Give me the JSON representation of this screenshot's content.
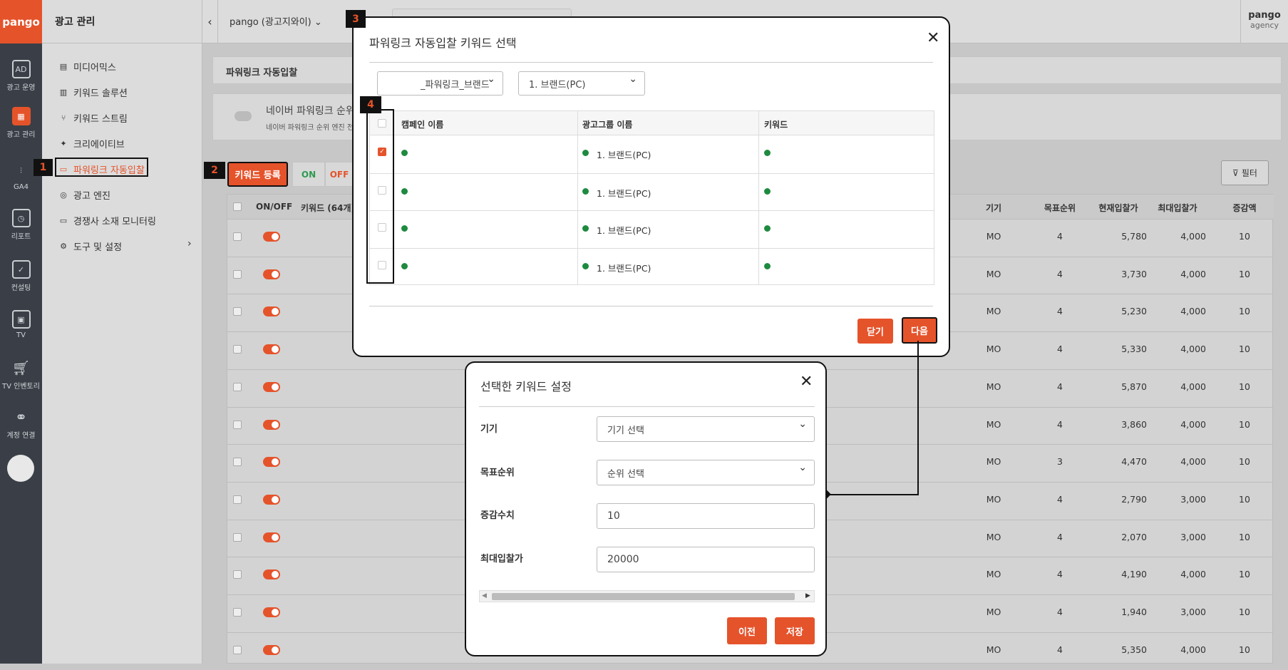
{
  "brand": {
    "logo": "pango",
    "accent": "#e5532b"
  },
  "rail": [
    {
      "icon": "ad-icon",
      "label": "광고 운영"
    },
    {
      "icon": "ad-manage-icon",
      "label": "광고 관리"
    },
    {
      "icon": "ga4-icon",
      "label": "GA4"
    },
    {
      "icon": "report-icon",
      "label": "리포트"
    },
    {
      "icon": "consulting-icon",
      "label": "컨설팅"
    },
    {
      "icon": "tv-icon",
      "label": "TV"
    },
    {
      "icon": "cart-icon",
      "label": "TV 인벤토리"
    },
    {
      "icon": "link-icon",
      "label": "계정 연결"
    }
  ],
  "sidebar": {
    "title": "광고 관리",
    "items": [
      "미디어믹스",
      "키워드 솔루션",
      "키워드 스트림",
      "크리에이티브",
      "파워링크 자동입찰",
      "광고 엔진",
      "경쟁사 소재 모니터링",
      "도구 및 설정"
    ]
  },
  "topbar": {
    "account": "pango (광고지와이)",
    "user": "pango",
    "role": "agency"
  },
  "page": {
    "title": "파워링크 자동입찰",
    "engine_title": "네이버 파워링크 순위",
    "engine_desc": "네이버 파워링크 순위 엔진 전",
    "register_btn": "키워드 등록",
    "on": "ON",
    "off": "OFF",
    "filter": "필터"
  },
  "table": {
    "headers": {
      "onoff": "ON/OFF",
      "keyword": "키워드 (64개)",
      "device": "기기",
      "rank": "목표순위",
      "current": "현재입찰가",
      "max": "최대입찰가",
      "inc": "증감액"
    },
    "rows": [
      {
        "device": "MO",
        "rank": "4",
        "current": "5,780",
        "max": "4,000",
        "inc": "10"
      },
      {
        "device": "MO",
        "rank": "4",
        "current": "3,730",
        "max": "4,000",
        "inc": "10"
      },
      {
        "device": "MO",
        "rank": "4",
        "current": "5,230",
        "max": "4,000",
        "inc": "10"
      },
      {
        "device": "MO",
        "rank": "4",
        "current": "5,330",
        "max": "4,000",
        "inc": "10"
      },
      {
        "device": "MO",
        "rank": "4",
        "current": "5,870",
        "max": "4,000",
        "inc": "10"
      },
      {
        "device": "MO",
        "rank": "4",
        "current": "3,860",
        "max": "4,000",
        "inc": "10"
      },
      {
        "device": "MO",
        "rank": "3",
        "current": "4,470",
        "max": "4,000",
        "inc": "10"
      },
      {
        "device": "MO",
        "rank": "4",
        "current": "2,790",
        "max": "3,000",
        "inc": "10"
      },
      {
        "device": "MO",
        "rank": "4",
        "current": "2,070",
        "max": "3,000",
        "inc": "10"
      },
      {
        "device": "MO",
        "rank": "4",
        "current": "4,190",
        "max": "4,000",
        "inc": "10"
      },
      {
        "device": "MO",
        "rank": "4",
        "current": "1,940",
        "max": "3,000",
        "inc": "10"
      },
      {
        "device": "MO",
        "rank": "4",
        "current": "5,350",
        "max": "4,000",
        "inc": "10"
      }
    ]
  },
  "modal1": {
    "title": "파워링크 자동입찰 키워드 선택",
    "campaign_select": "_파워링크_브랜드",
    "group_select": "1. 브랜드(PC)",
    "headers": {
      "campaign": "캠페인 이름",
      "group": "광고그룹 이름",
      "keyword": "키워드"
    },
    "rows": [
      {
        "group": "1. 브랜드(PC)",
        "checked": true
      },
      {
        "group": "1. 브랜드(PC)",
        "checked": false
      },
      {
        "group": "1. 브랜드(PC)",
        "checked": false
      },
      {
        "group": "1. 브랜드(PC)",
        "checked": false
      }
    ],
    "close_btn": "닫기",
    "next_btn": "다음"
  },
  "modal2": {
    "title": "선택한 키워드 설정",
    "device_label": "기기",
    "device_select": "기기 선택",
    "rank_label": "목표순위",
    "rank_select": "순위 선택",
    "inc_label": "증감수치",
    "inc_value": "10",
    "max_label": "최대입찰가",
    "max_value": "20000",
    "prev_btn": "이전",
    "save_btn": "저장"
  },
  "badges": [
    "1",
    "2",
    "3",
    "4"
  ]
}
